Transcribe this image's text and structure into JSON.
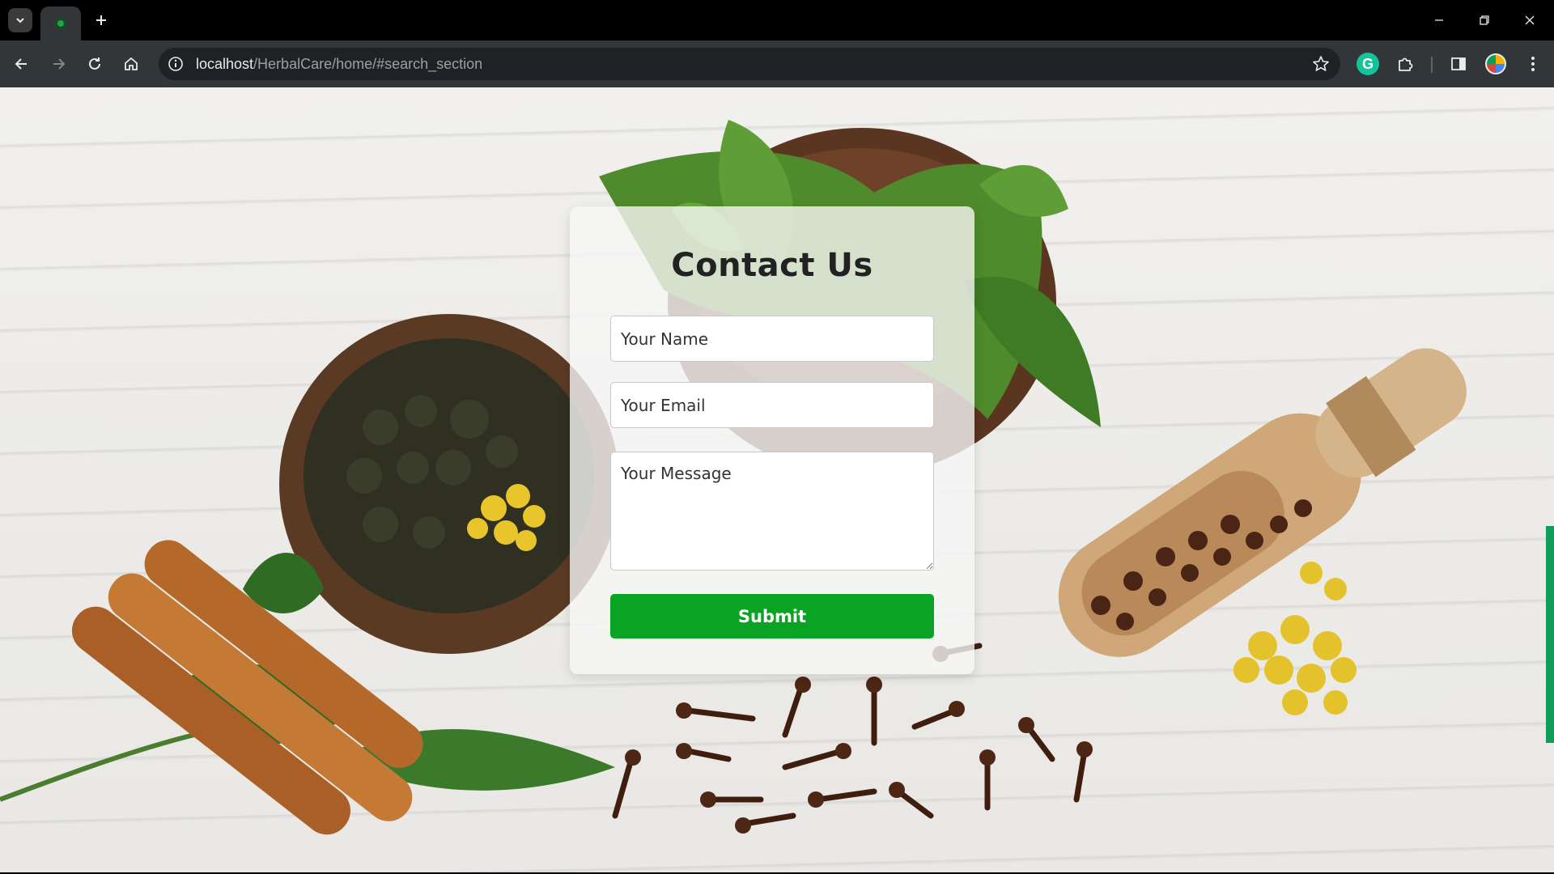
{
  "browser": {
    "url_host": "localhost",
    "url_path": "/HerbalCare/home/#search_section",
    "grammarly_letter": "G"
  },
  "contact": {
    "title": "Contact Us",
    "name_placeholder": "Your Name",
    "email_placeholder": "Your Email",
    "message_placeholder": "Your Message",
    "submit_label": "Submit"
  },
  "colors": {
    "accent_green": "#0ba324",
    "scrollbar": "#0f9d58"
  }
}
